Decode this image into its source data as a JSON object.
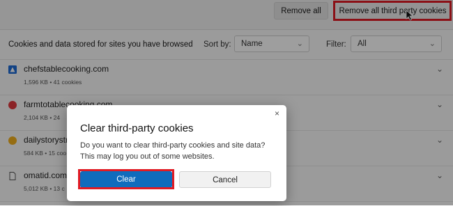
{
  "header": {
    "remove_all_label": "Remove all",
    "remove_third_party_label": "Remove all third party cookies"
  },
  "toolbar": {
    "title": "Cookies and data stored for sites you have browsed",
    "sort_by_label": "Sort by:",
    "sort_by_value": "Name",
    "filter_label": "Filter:",
    "filter_value": "All"
  },
  "sites": [
    {
      "name": "chefstablecooking.com",
      "meta": "1,596 KB  •  41 cookies",
      "icon": "triangle-icon",
      "color": "#1e6bd6"
    },
    {
      "name": "farmtotablecooking.com",
      "meta": "2,104 KB  •  24",
      "icon": "circle-icon",
      "color": "#e0393e"
    },
    {
      "name": "dailystorystr",
      "meta": "584 KB  •  15 coo",
      "icon": "circle-icon",
      "color": "#f2b01e"
    },
    {
      "name": "omatid.com",
      "meta": "5,012 KB  •  13 c",
      "icon": "document-icon",
      "color": "#555555"
    }
  ],
  "dialog": {
    "title": "Clear third-party cookies",
    "body": "Do you want to clear third-party cookies and site data? This may log you out of some websites.",
    "clear_label": "Clear",
    "cancel_label": "Cancel",
    "close_glyph": "×"
  },
  "colors": {
    "accent": "#0f6cbd",
    "highlight": "#e01b24"
  }
}
